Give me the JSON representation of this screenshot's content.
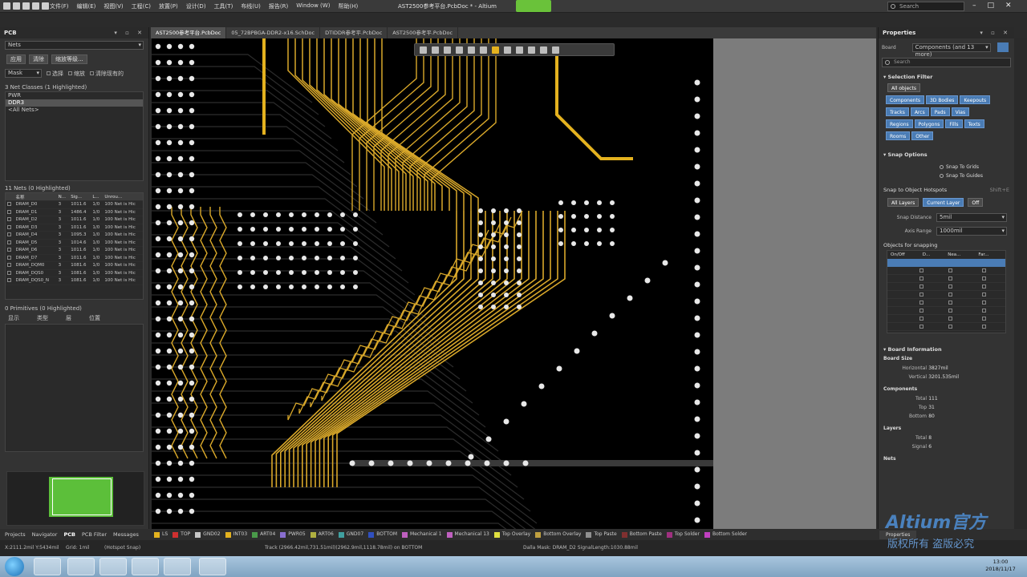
{
  "app": {
    "title": "AST2500参考平台.PcbDoc * - Altium",
    "search_placeholder": "Search",
    "menus": [
      "文件(F)",
      "编辑(E)",
      "视图(V)",
      "工程(C)",
      "放置(P)",
      "设计(D)",
      "工具(T)",
      "布线(U)",
      "报告(R)",
      "Window (W)",
      "帮助(H)"
    ]
  },
  "left_panel": {
    "title": "PCB",
    "mode": "Nets",
    "buttons": [
      "应用",
      "清除",
      "缩放等级..."
    ],
    "filter_mode": "Mask",
    "filter_options": [
      "选择",
      "缩放",
      "清除现有的"
    ],
    "classes_title": "3 Net Classes (1 Highlighted)",
    "classes": [
      "PWR",
      "DDR3",
      "<All Nets>"
    ],
    "nets_title": "11 Nets (0 Highlighted)",
    "nets_columns": [
      "名称",
      "N...",
      "Sig...",
      "L...",
      "Unrou..."
    ],
    "nets": [
      {
        "name": "DRAM_D0",
        "n": "3",
        "sig": "1011.6",
        "l": "1/0",
        "unrouted": "100 Net is Hic"
      },
      {
        "name": "DRAM_D1",
        "n": "3",
        "sig": "1486.4",
        "l": "1/0",
        "unrouted": "100 Net is Hic"
      },
      {
        "name": "DRAM_D2",
        "n": "3",
        "sig": "1011.6",
        "l": "1/0",
        "unrouted": "100 Net is Hic"
      },
      {
        "name": "DRAM_D3",
        "n": "3",
        "sig": "1011.6",
        "l": "1/0",
        "unrouted": "100 Net is Hic"
      },
      {
        "name": "DRAM_D4",
        "n": "3",
        "sig": "1095.3",
        "l": "1/0",
        "unrouted": "100 Net is Hic"
      },
      {
        "name": "DRAM_D5",
        "n": "3",
        "sig": "1014.6",
        "l": "1/0",
        "unrouted": "100 Net is Hic"
      },
      {
        "name": "DRAM_D6",
        "n": "3",
        "sig": "1011.6",
        "l": "1/0",
        "unrouted": "100 Net is Hic"
      },
      {
        "name": "DRAM_D7",
        "n": "3",
        "sig": "1011.6",
        "l": "1/0",
        "unrouted": "100 Net is Hic"
      },
      {
        "name": "DRAM_DQM0",
        "n": "3",
        "sig": "1081.6",
        "l": "1/0",
        "unrouted": "100 Net is Hic"
      },
      {
        "name": "DRAM_DQS0",
        "n": "3",
        "sig": "1081.6",
        "l": "1/0",
        "unrouted": "100 Net is Hic"
      },
      {
        "name": "DRAM_DQS0_N",
        "n": "3",
        "sig": "1081.6",
        "l": "1/0",
        "unrouted": "100 Net is Hic"
      }
    ],
    "primitives_title": "0 Primitives (0 Highlighted)",
    "primitive_buttons": [
      "显示",
      "类型",
      "层",
      "位置"
    ]
  },
  "doc_tabs": [
    {
      "label": "AST2500参考平台.PcbDoc",
      "active": true
    },
    {
      "label": "05_72BPBGA-DDR2-x16.SchDoc",
      "active": false
    },
    {
      "label": "DTIDDR参考平.PcbDoc",
      "active": false
    },
    {
      "label": "AST2500参考平.PcbDoc",
      "active": false
    }
  ],
  "properties": {
    "title": "Properties",
    "board_label": "Board",
    "board_value": "Components (and 13 more)",
    "search_placeholder": "Search",
    "selection_filter_title": "Selection Filter",
    "all_objects": "All objects",
    "filter_buttons": [
      "Components",
      "3D Bodies",
      "Keepouts",
      "Tracks",
      "Arcs",
      "Pads",
      "Vias",
      "Regions",
      "Polygons",
      "Fills",
      "Texts",
      "Rooms",
      "Other"
    ],
    "snap_options_title": "Snap Options",
    "snap_grids": "Snap To Grids",
    "snap_guides": "Snap To Guides",
    "snap_hotspots_title": "Snap to Object Hotspots",
    "hotspot_shortcut": "Shift+E",
    "hotspot_buttons": [
      "All Layers",
      "Current Layer",
      "Off"
    ],
    "snap_distance_label": "Snap Distance",
    "snap_distance_value": "5mil",
    "axis_range_label": "Axis Range",
    "axis_range_value": "1000mil",
    "objects_snapping_title": "Objects for snapping",
    "objects_cols": [
      "On/Off",
      "D...",
      "Nea...",
      "Far..."
    ],
    "board_info_title": "Board Information",
    "board_size_title": "Board Size",
    "horizontal_label": "Horizontal",
    "horizontal_value": "3827mil",
    "vertical_label": "Vertical",
    "vertical_value": "3201.535mil",
    "components_title": "Components",
    "comp_total_label": "Total",
    "comp_total_value": "111",
    "comp_top_label": "Top",
    "comp_top_value": "31",
    "comp_bottom_label": "Bottom",
    "comp_bottom_value": "80",
    "layers_title": "Layers",
    "layers_total_label": "Total",
    "layers_total_value": "8",
    "layers_signal_label": "Signal",
    "layers_signal_value": "6",
    "nets_title": "Nets",
    "properties_tab": "Properties"
  },
  "panel_tabs": [
    "Projects",
    "Navigator",
    "PCB",
    "PCB Filter",
    "Messages"
  ],
  "layer_tabs": [
    {
      "name": "LS",
      "color": "#e4b21f"
    },
    {
      "name": "TOP",
      "color": "#d03030"
    },
    {
      "name": "GND02",
      "color": "#c8c8c8"
    },
    {
      "name": "INT03",
      "color": "#e4b21f"
    },
    {
      "name": "ART04",
      "color": "#4a9a4a"
    },
    {
      "name": "PWR05",
      "color": "#8a6fd0"
    },
    {
      "name": "ART06",
      "color": "#b0b040"
    },
    {
      "name": "GND07",
      "color": "#40a0a0"
    },
    {
      "name": "BOTTOM",
      "color": "#3050c0"
    },
    {
      "name": "Mechanical 1",
      "color": "#c060c0"
    },
    {
      "name": "Mechanical 13",
      "color": "#c060c0"
    },
    {
      "name": "Top Overlay",
      "color": "#e0e040"
    },
    {
      "name": "Bottom Overlay",
      "color": "#c0a040"
    },
    {
      "name": "Top Paste",
      "color": "#909090"
    },
    {
      "name": "Bottom Paste",
      "color": "#803030"
    },
    {
      "name": "Top Solder",
      "color": "#a03080"
    },
    {
      "name": "Bottom Solder",
      "color": "#c040c0"
    }
  ],
  "status": {
    "coords": "X:2111.2mil Y:5434mil",
    "grid": "Grid: 1mil",
    "hotspot": "(Hotspot Snap)",
    "net_info": "Track (2966.42mil,731.51mil)(2962.9mil,1118.78mil) on BOTTOM",
    "selection": "Dalla Mask: DRAM_D2 SignalLength:1030.88mil"
  },
  "taskbar": {
    "time": "13:00",
    "date": "2018/11/17"
  },
  "watermark": {
    "main": "Altium官方",
    "sub": "版权所有 盗版必究"
  }
}
